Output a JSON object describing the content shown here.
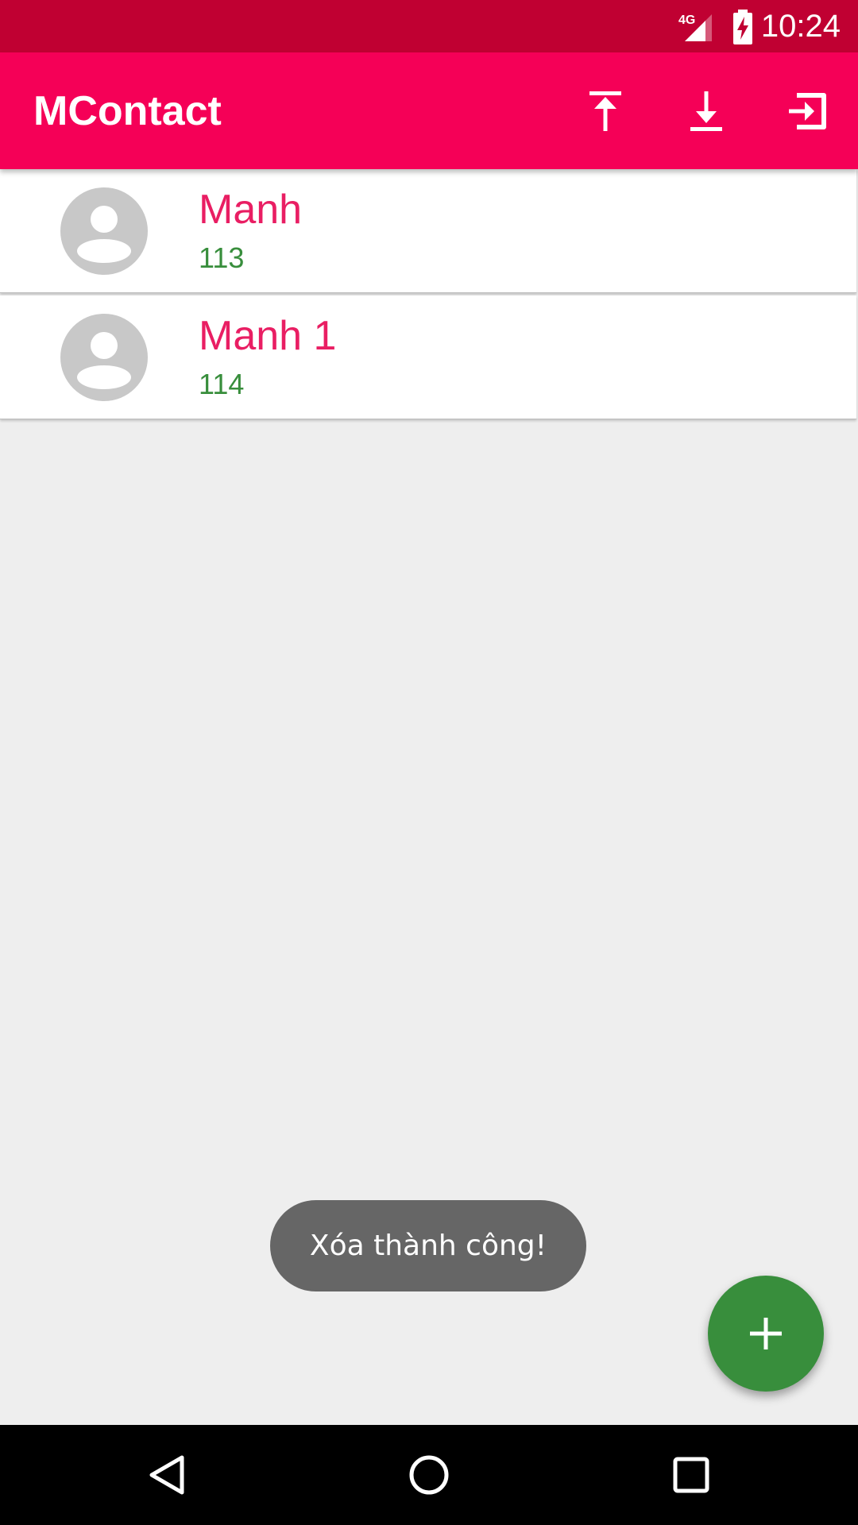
{
  "status_bar": {
    "network": "4G",
    "time": "10:24"
  },
  "app_bar": {
    "title": "MContact",
    "actions": [
      {
        "icon": "upload-icon"
      },
      {
        "icon": "download-icon"
      },
      {
        "icon": "exit-icon"
      }
    ]
  },
  "contacts": [
    {
      "name": "Manh",
      "phone": "113",
      "avatar": "person-icon"
    },
    {
      "name": "Manh 1",
      "phone": "114",
      "avatar": "person-icon"
    }
  ],
  "toast": {
    "message": "Xóa thành công!"
  },
  "fab": {
    "icon": "plus-icon"
  },
  "colors": {
    "status_bar": "#c00032",
    "primary": "#f50057",
    "name_text": "#e91e63",
    "phone_text": "#388e3c",
    "fab": "#388e3c",
    "background": "#eeeeee"
  }
}
